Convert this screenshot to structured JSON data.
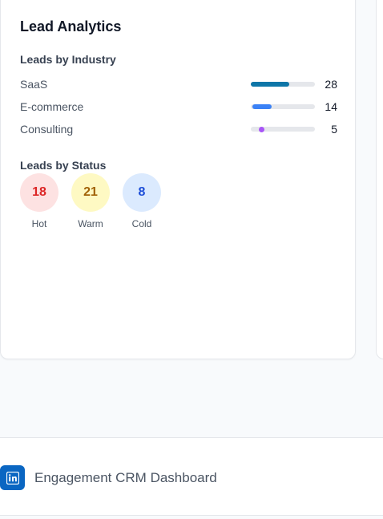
{
  "card": {
    "title": "Lead Analytics",
    "industry_section": "Leads by Industry",
    "industries": [
      {
        "label": "SaaS",
        "count": "28",
        "fraction": 0.6,
        "color": "#0e76a8"
      },
      {
        "label": "E-commerce",
        "count": "14",
        "fraction": 0.3,
        "color": "#3b82f6"
      },
      {
        "label": "Consulting",
        "count": "5",
        "fraction": 0.1,
        "color": "#a855f7"
      }
    ],
    "status_section": "Leads by Status",
    "statuses": [
      {
        "label": "Hot",
        "count": "18",
        "bg": "#fde2e2",
        "fg": "#dc2626"
      },
      {
        "label": "Warm",
        "count": "21",
        "bg": "#fef9c3",
        "fg": "#a16207"
      },
      {
        "label": "Cold",
        "count": "8",
        "bg": "#dbeafe",
        "fg": "#1d4ed8"
      }
    ]
  },
  "footer": {
    "icon": "linkedin-icon",
    "brand_color": "#0a66c2",
    "text": "Engagement CRM Dashboard"
  }
}
